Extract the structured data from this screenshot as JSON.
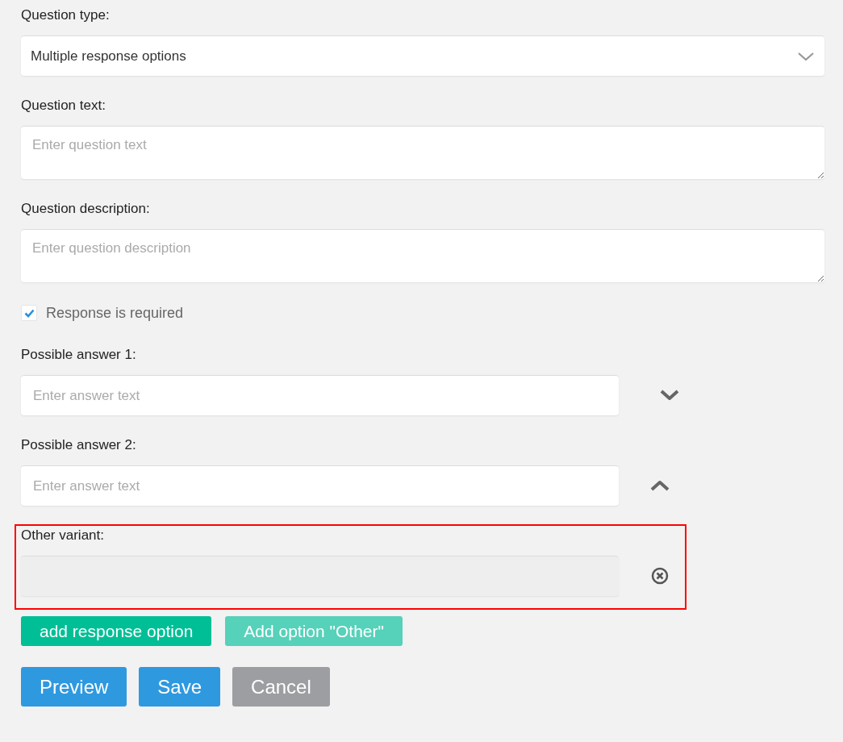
{
  "question_type": {
    "label": "Question type:",
    "value": "Multiple response options"
  },
  "question_text": {
    "label": "Question text:",
    "placeholder": "Enter question text"
  },
  "question_description": {
    "label": "Question description:",
    "placeholder": "Enter question description"
  },
  "required": {
    "label": "Response is required",
    "checked": true
  },
  "answers": [
    {
      "label": "Possible answer 1:",
      "placeholder": "Enter answer text",
      "kind": "move-down",
      "disabled": false,
      "highlighted": false
    },
    {
      "label": "Possible answer 2:",
      "placeholder": "Enter answer text",
      "kind": "move-up",
      "disabled": false,
      "highlighted": false
    },
    {
      "label": "Other variant:",
      "kind": "remove",
      "disabled": true,
      "highlighted": true
    }
  ],
  "option_buttons": [
    {
      "label": "add response option",
      "disabled": false
    },
    {
      "label": "Add option \"Other\"",
      "disabled": true
    }
  ],
  "actions": [
    {
      "label": "Preview",
      "kind": "primary"
    },
    {
      "label": "Save",
      "kind": "primary"
    },
    {
      "label": "Cancel",
      "kind": "secondary"
    }
  ]
}
